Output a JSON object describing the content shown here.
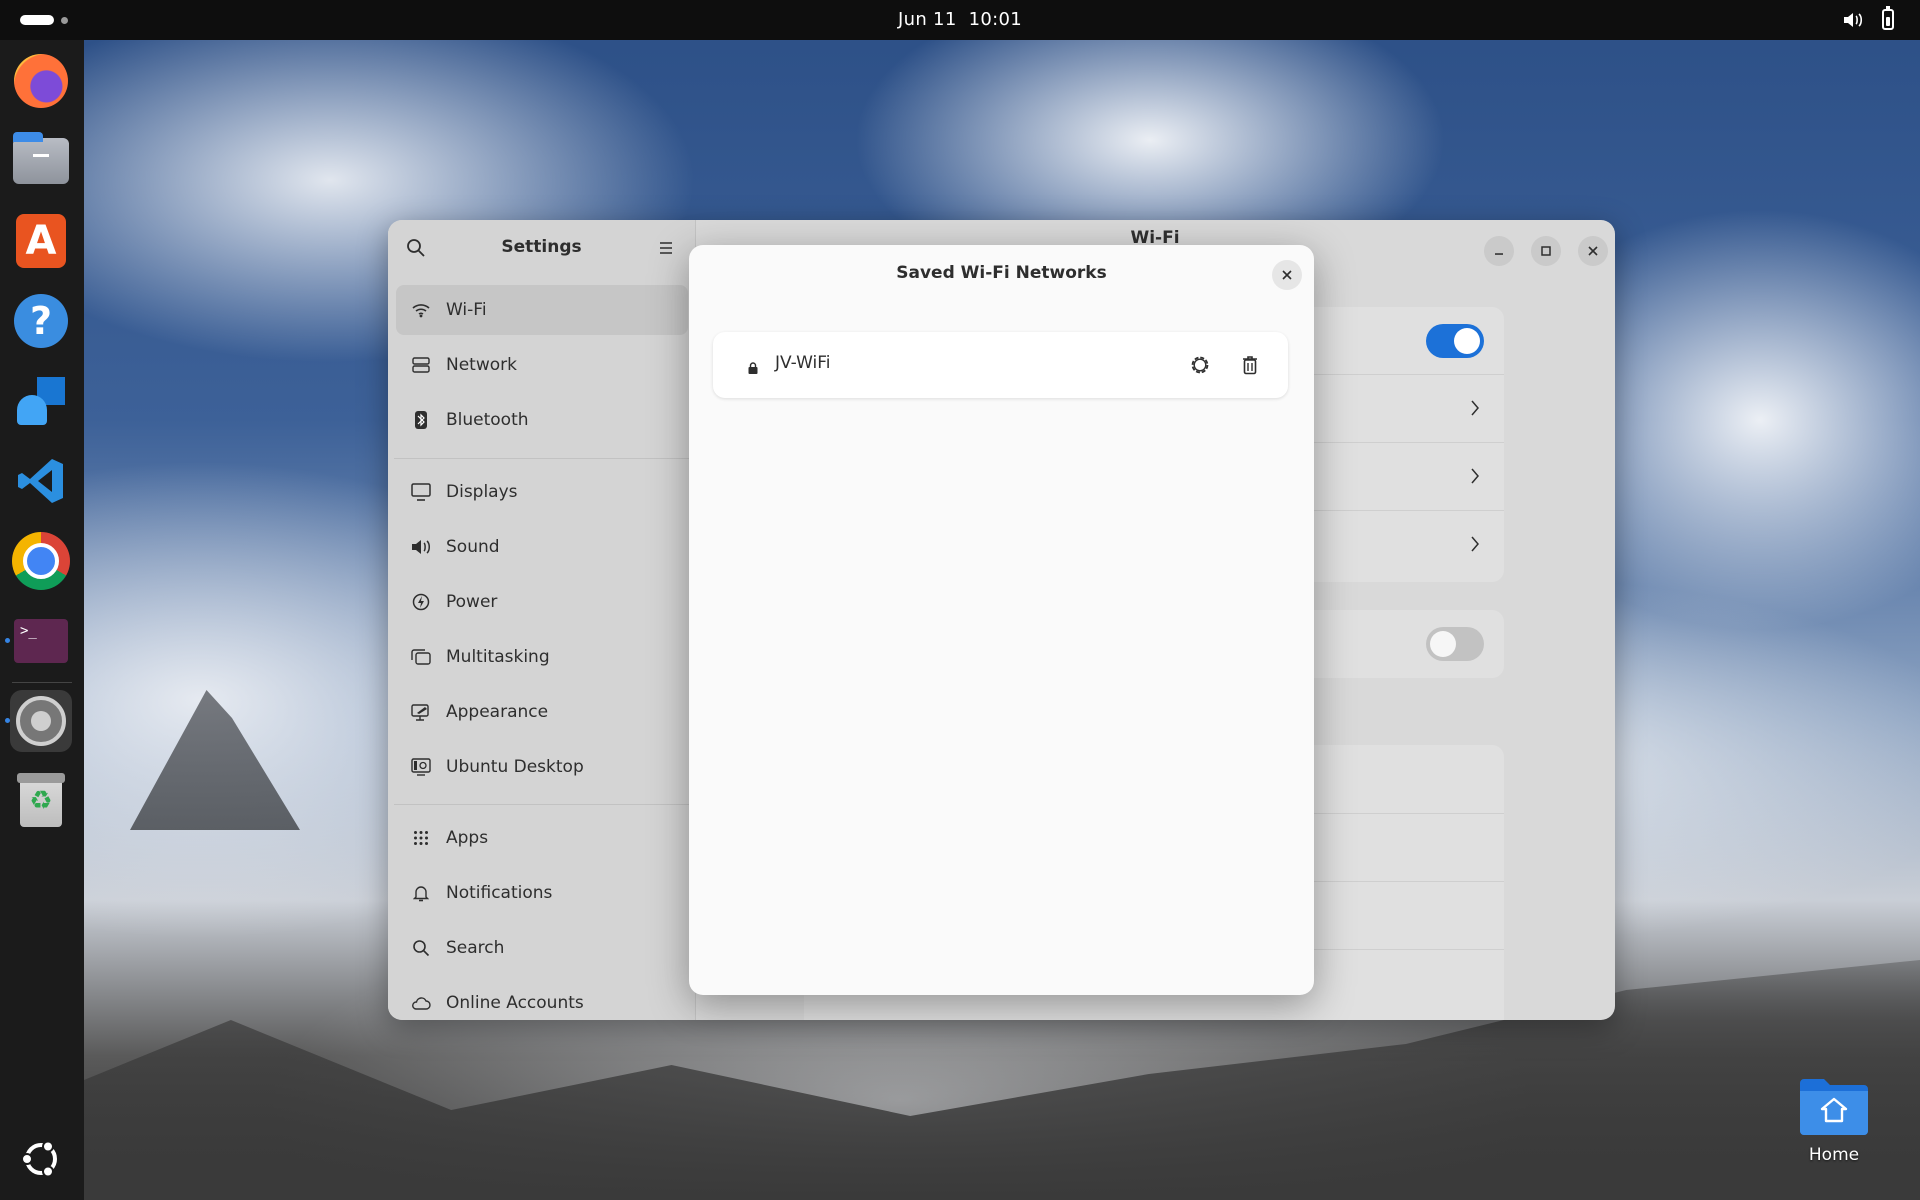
{
  "topbar": {
    "date": "Jun 11",
    "time": "10:01",
    "tray": [
      "volume-icon",
      "battery-icon"
    ]
  },
  "dock": {
    "apps": [
      {
        "name": "Firefox",
        "icon": "firefox-icon"
      },
      {
        "name": "Files",
        "icon": "files-icon"
      },
      {
        "name": "App Center",
        "icon": "app-center-icon"
      },
      {
        "name": "Help",
        "icon": "help-icon"
      },
      {
        "name": "Remote Desktop",
        "icon": "remote-desktop-icon"
      },
      {
        "name": "Visual Studio Code",
        "icon": "vscode-icon"
      },
      {
        "name": "Google Chrome",
        "icon": "chrome-icon"
      },
      {
        "name": "Terminal",
        "icon": "terminal-icon",
        "running": true
      },
      {
        "name": "Settings",
        "icon": "settings-icon",
        "running": true,
        "active": true
      },
      {
        "name": "Trash",
        "icon": "trash-icon"
      }
    ],
    "show_apps_icon": "ubuntu-icon",
    "terminal_prompt": ">_"
  },
  "settings": {
    "sidebar_title": "Settings",
    "page_title": "Wi-Fi",
    "sidebar_groups": [
      [
        {
          "label": "Wi-Fi",
          "icon": "wifi-icon",
          "selected": true
        },
        {
          "label": "Network",
          "icon": "network-icon"
        },
        {
          "label": "Bluetooth",
          "icon": "bluetooth-icon"
        }
      ],
      [
        {
          "label": "Displays",
          "icon": "display-icon"
        },
        {
          "label": "Sound",
          "icon": "speaker-icon"
        },
        {
          "label": "Power",
          "icon": "power-icon"
        },
        {
          "label": "Multitasking",
          "icon": "multitasking-icon"
        },
        {
          "label": "Appearance",
          "icon": "appearance-icon"
        },
        {
          "label": "Ubuntu Desktop",
          "icon": "ubuntu-desktop-icon"
        }
      ],
      [
        {
          "label": "Apps",
          "icon": "apps-grid-icon"
        },
        {
          "label": "Notifications",
          "icon": "bell-icon"
        },
        {
          "label": "Search",
          "icon": "search-icon"
        },
        {
          "label": "Online Accounts",
          "icon": "cloud-icon"
        }
      ]
    ],
    "wifi_enabled": true,
    "hotspot_enabled": false
  },
  "dialog": {
    "title": "Saved Wi-Fi Networks",
    "networks": [
      {
        "name": "JV-WiFi",
        "secured": true
      }
    ]
  },
  "desktop": {
    "home_label": "Home"
  },
  "colors": {
    "accent": "#1c71d8",
    "dock_bg": "#1b1b1b",
    "topbar_bg": "#0e0e0e",
    "terminal": "#5e2750",
    "ubuntu_orange": "#e95420"
  }
}
